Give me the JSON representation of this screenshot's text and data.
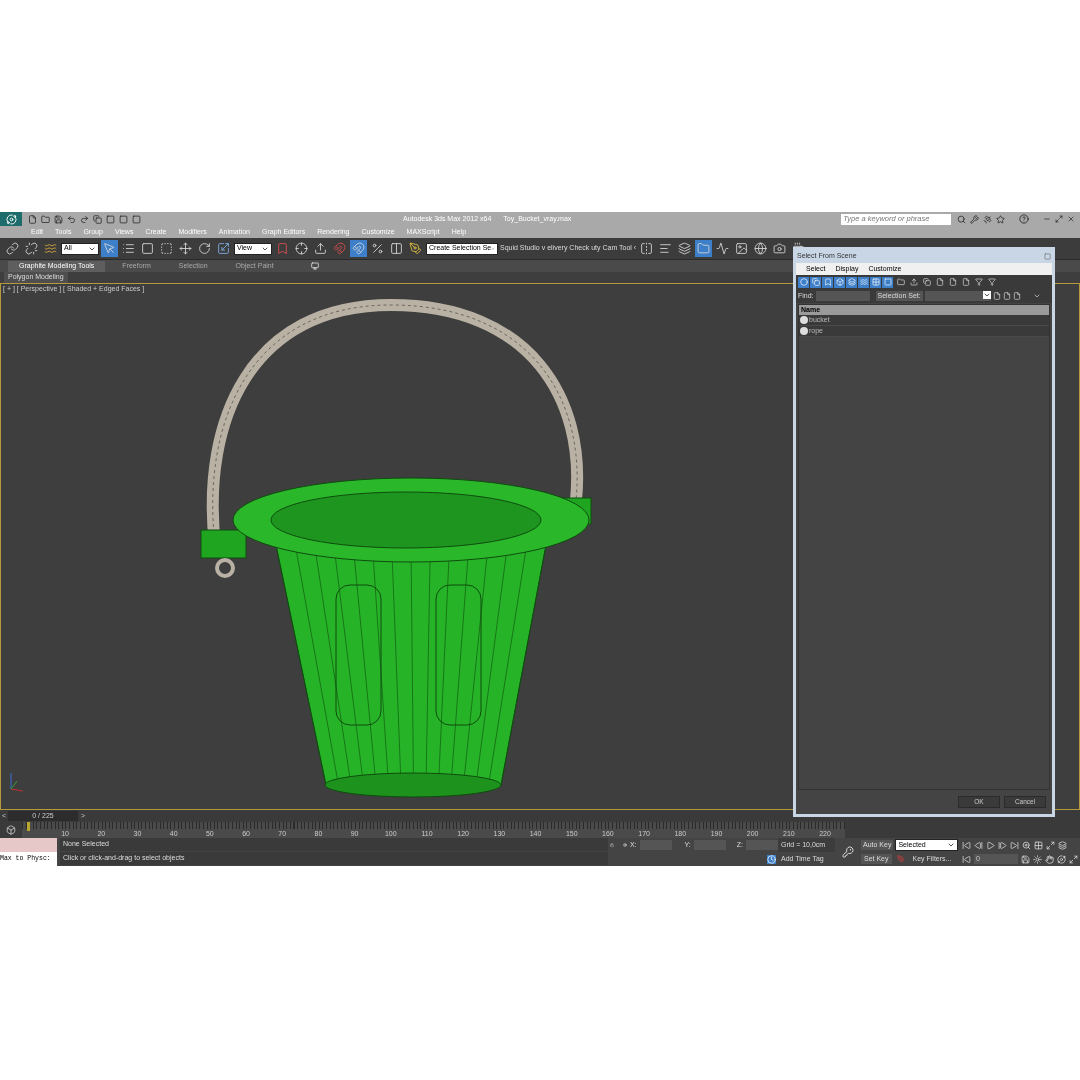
{
  "app": {
    "title": "Autodesk 3ds Max  2012 x64",
    "file": "Toy_Bucket_vray.max"
  },
  "search": {
    "placeholder": "Type a keyword or phrase"
  },
  "menu": [
    "Edit",
    "Tools",
    "Group",
    "Views",
    "Create",
    "Modifiers",
    "Animation",
    "Graph Editors",
    "Rendering",
    "Customize",
    "MAXScript",
    "Help"
  ],
  "toolbar": {
    "selection_filter": "All",
    "reference_coord": "View",
    "named_selection": "Create Selection Se",
    "custom_buttons": [
      "Squid Studio v",
      "elivery Check",
      "uty Cam Tool ‹"
    ]
  },
  "ribbon_tabs": [
    {
      "label": "Graphite Modeling Tools",
      "selected": true
    },
    {
      "label": "Freeform",
      "selected": false
    },
    {
      "label": "Selection",
      "selected": false
    },
    {
      "label": "Object Paint",
      "selected": false
    }
  ],
  "ribbon_panel": "Polygon Modeling",
  "viewport": {
    "label": "[ + ] [ Perspective ] [ Shaded + Edged Faces ]"
  },
  "dialog": {
    "title": "Select From Scene",
    "menu": [
      "Select",
      "Display",
      "Customize"
    ],
    "find_label": "Find:",
    "selection_set_label": "Selection Set:",
    "column": "Name",
    "rows": [
      {
        "name": "bucket"
      },
      {
        "name": "rope"
      }
    ],
    "buttons": [
      "OK",
      "Cancel"
    ]
  },
  "timeline": {
    "prev": "<",
    "frame": "0 / 225",
    "level": 0,
    "next": ">",
    "ticks": [
      "10",
      "20",
      "30",
      "40",
      "50",
      "60",
      "70",
      "80",
      "90",
      "100",
      "110",
      "120",
      "130",
      "140",
      "150",
      "160",
      "170",
      "180",
      "190",
      "200",
      "210",
      "220"
    ]
  },
  "status": {
    "maxscript": "Max to Physc:",
    "selection": "None Selected",
    "prompt": "Click or click-and-drag to select objects",
    "x_label": "X:",
    "y_label": "Y:",
    "z_label": "Z:",
    "grid": "Grid = 10,0cm",
    "add_time_tag": "Add Time Tag",
    "auto_key": "Auto Key",
    "key_mode": "Selected",
    "set_key": "Set Key",
    "key_filters": "Key Filters...",
    "frame_value": "0"
  }
}
